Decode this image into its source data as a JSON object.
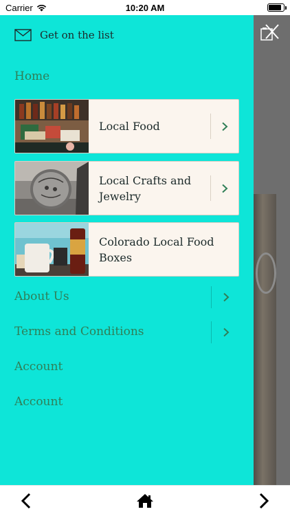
{
  "status_bar": {
    "carrier": "Carrier",
    "time": "10:20 AM",
    "battery_level": 0.85
  },
  "drawer": {
    "newsletter_label": "Get on the list",
    "home_label": "Home",
    "cards": [
      {
        "label": "Local Food",
        "image": "shelf-of-local-food-products"
      },
      {
        "label": "Local Crafts and Jewelry",
        "image": "stamped-metal-pendant"
      },
      {
        "label": "Colorado Local Food Boxes",
        "image": "mug-candle-and-sauce-bottles"
      }
    ],
    "about_label": "About Us",
    "terms_label": "Terms and Conditions",
    "account_label_1": "Account",
    "account_label_2": "Account",
    "icons": {
      "newsletter": "envelope-icon",
      "close": "close-icon",
      "chevron": "chevron-right-icon",
      "back": "chevron-left-icon",
      "home": "home-icon",
      "forward": "chevron-right-icon"
    }
  },
  "colors": {
    "drawer_background": "#0ee5d8",
    "nav_text": "#2f7f57",
    "card_background": "#fbf5ee",
    "chevron": "#2f7f57"
  }
}
